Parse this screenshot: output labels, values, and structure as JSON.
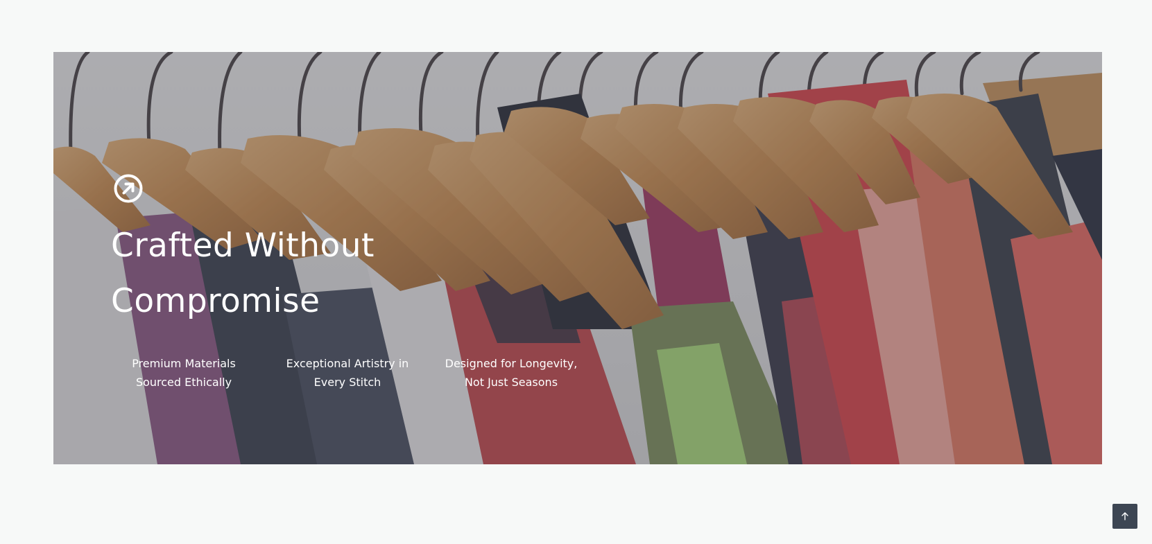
{
  "hero": {
    "title_line1": "Crafted Without",
    "title_line2": "Compromise",
    "icon": "arrow-up-right-circle-icon",
    "background_image": "clothes-on-wooden-hangers-photo",
    "features": [
      {
        "line1": "Premium Materials",
        "line2": "Sourced Ethically"
      },
      {
        "line1": "Exceptional Artistry in",
        "line2": "Every Stitch"
      },
      {
        "line1": "Designed for Longevity,",
        "line2": "Not Just Seasons"
      }
    ]
  },
  "back_to_top": {
    "icon": "arrow-up-icon"
  },
  "colors": {
    "page_background": "#f7f9f8",
    "button_background": "#3d4653",
    "text": "#ffffff"
  }
}
